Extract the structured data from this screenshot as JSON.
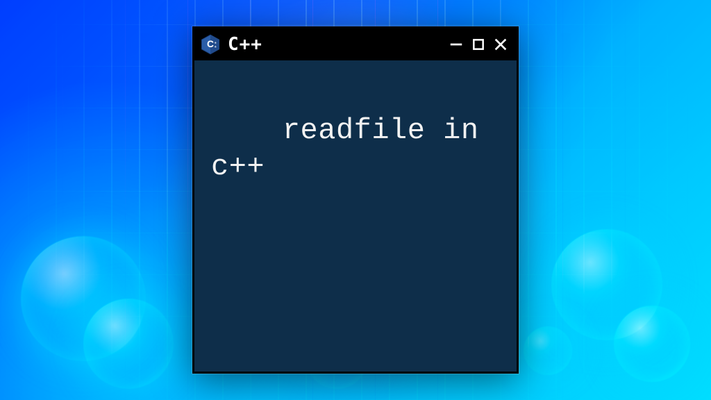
{
  "window": {
    "title": "C++",
    "logo_name": "cpp-logo-icon",
    "controls": {
      "minimize": "minimize-icon",
      "maximize": "maximize-icon",
      "close": "close-icon"
    }
  },
  "content": {
    "text": "readfile in\nc++"
  },
  "colors": {
    "terminal_bg": "#0e2e4a",
    "titlebar_bg": "#000000",
    "text": "#f2f2f2",
    "glow": "#5ad7ff"
  }
}
